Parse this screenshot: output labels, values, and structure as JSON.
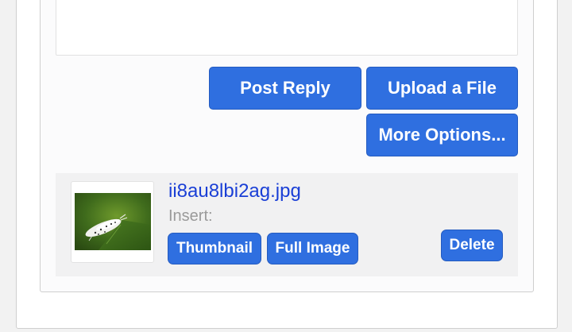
{
  "actions": {
    "post_reply_label": "Post Reply",
    "upload_label": "Upload a File",
    "more_options_label": "More Options..."
  },
  "attachment": {
    "filename": "ii8au8lbi2ag.jpg",
    "insert_label": "Insert:",
    "thumbnail_label": "Thumbnail",
    "full_image_label": "Full Image",
    "delete_label": "Delete",
    "thumbnail_icon": "moth-photo-icon"
  },
  "colors": {
    "button": "#2f6fe0",
    "link": "#1a3fd6"
  }
}
